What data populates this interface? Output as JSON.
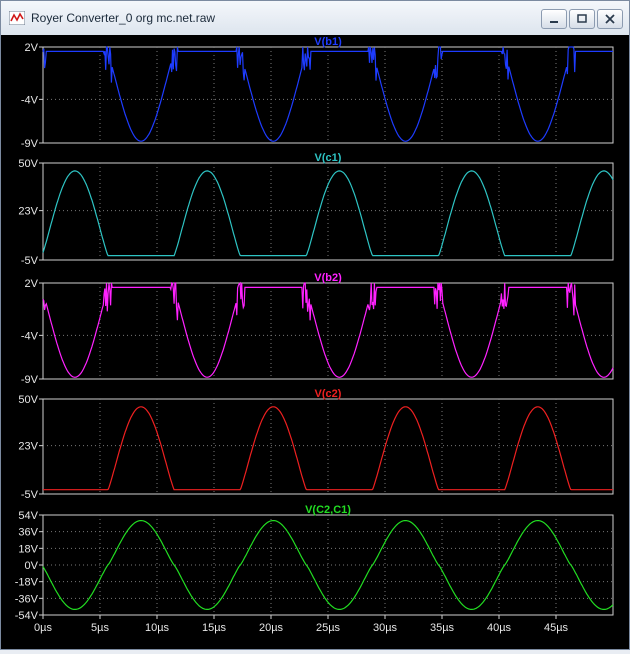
{
  "window": {
    "title": "Royer Converter_0 org mc.net.raw"
  },
  "icons": {
    "app": "waveform-app-icon",
    "minimize": "minimize-icon",
    "maximize": "maximize-icon",
    "close": "close-icon"
  },
  "colors": {
    "background": "#000000",
    "grid": "#777777",
    "axis_text": "#e6e6e6"
  },
  "chart_data": {
    "type": "line",
    "x_axis": {
      "unit": "µs",
      "range": [
        0,
        50
      ],
      "tick_labels": [
        "0µs",
        "5µs",
        "10µs",
        "15µs",
        "20µs",
        "25µs",
        "30µs",
        "35µs",
        "40µs",
        "45µs"
      ]
    },
    "grid": true,
    "panes": [
      {
        "id": "b1",
        "title": "V(b1)",
        "color": "#1e3cff",
        "ylim": [
          -9,
          2
        ],
        "tick_labels": [
          "2V",
          "-4V",
          "-9V"
        ],
        "tick_values": [
          2,
          -4,
          -9
        ]
      },
      {
        "id": "c1",
        "title": "V(c1)",
        "color": "#2ec4c4",
        "ylim": [
          -5,
          50
        ],
        "tick_labels": [
          "50V",
          "23V",
          "-5V"
        ],
        "tick_values": [
          50,
          23,
          -5
        ]
      },
      {
        "id": "b2",
        "title": "V(b2)",
        "color": "#ff22ff",
        "ylim": [
          -9,
          2
        ],
        "tick_labels": [
          "2V",
          "-4V",
          "-9V"
        ],
        "tick_values": [
          2,
          -4,
          -9
        ]
      },
      {
        "id": "c2",
        "title": "V(c2)",
        "color": "#ee2020",
        "ylim": [
          -5,
          50
        ],
        "tick_labels": [
          "50V",
          "23V",
          "-5V"
        ],
        "tick_values": [
          50,
          23,
          -5
        ]
      },
      {
        "id": "c2c1",
        "title": "V(C2,C1)",
        "color": "#22dd22",
        "ylim": [
          -54,
          54
        ],
        "tick_labels": [
          "54V",
          "36V",
          "18V",
          "0V",
          "-18V",
          "-36V",
          "-54V"
        ],
        "tick_values": [
          54,
          36,
          18,
          0,
          -18,
          -36,
          -54
        ]
      }
    ]
  }
}
